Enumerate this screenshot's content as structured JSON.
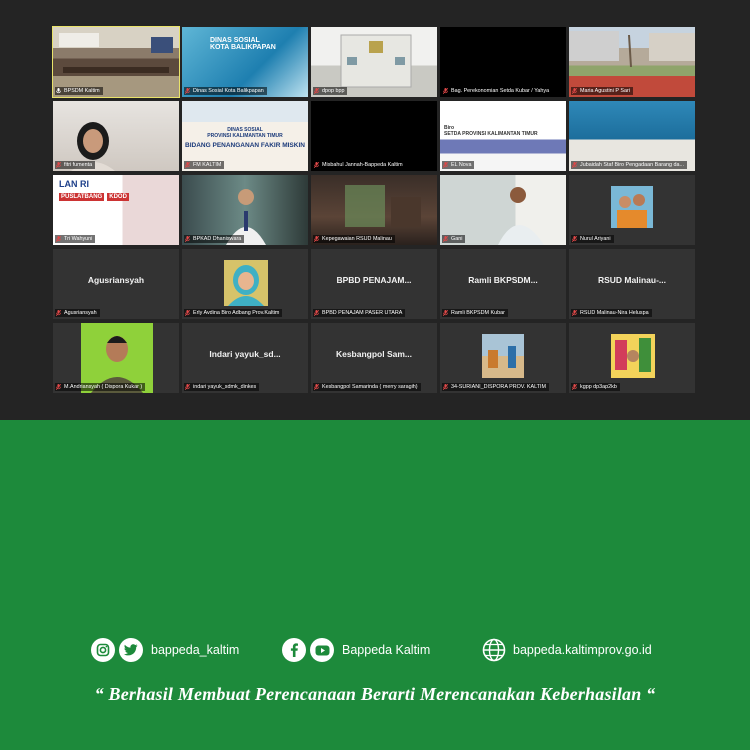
{
  "meeting": {
    "participants": [
      {
        "label": "BPSDM Kaltim",
        "center_name": "",
        "scene": "room",
        "active": true,
        "muted": false
      },
      {
        "label": "Dinas Sosial Kota Balikpapan",
        "center_name": "",
        "scene": "dinsos",
        "active": false,
        "muted": true,
        "overlay_lines": [
          "DINAS SOSIAL",
          "KOTA BALIKPAPAN"
        ]
      },
      {
        "label": "dpop bpp",
        "center_name": "",
        "scene": "building",
        "active": false,
        "muted": true
      },
      {
        "label": "Bag. Perekonomian Setda Kubar / Yahya",
        "center_name": "",
        "scene": "black",
        "active": false,
        "muted": true
      },
      {
        "label": "Maria Agustini P Sari",
        "center_name": "",
        "scene": "street",
        "active": false,
        "muted": true
      },
      {
        "label": "fitri fumenta",
        "center_name": "",
        "scene": "face",
        "active": false,
        "muted": true
      },
      {
        "label": "FM KALTIM",
        "center_name": "",
        "scene": "banner",
        "active": false,
        "muted": true,
        "overlay_lines": [
          "DINAS SOSIAL",
          "PROVINSI KALIMANTAN TIMUR",
          "BIDANG PENANGANAN FAKIR MISKIN"
        ]
      },
      {
        "label": "Misbahul Jannah-Bappeda Kaltim",
        "center_name": "",
        "scene": "black",
        "active": false,
        "muted": true
      },
      {
        "label": "EL Nova",
        "center_name": "",
        "scene": "slide",
        "active": false,
        "muted": true,
        "overlay_lines": [
          "Biro",
          "SETDA PROVINSI KALIMANTAN TIMUR"
        ]
      },
      {
        "label": "Jubaidah Staf Biro Pengadaan Barang da...",
        "center_name": "",
        "scene": "sky",
        "active": false,
        "muted": true
      },
      {
        "label": "Tri Wahyuni",
        "center_name": "",
        "scene": "lan",
        "active": false,
        "muted": true,
        "overlay_lines": [
          "LAN RI",
          "PUSLATBANG",
          "KDOD"
        ]
      },
      {
        "label": "BPKAD Dhaniswara",
        "center_name": "",
        "scene": "office",
        "active": false,
        "muted": true
      },
      {
        "label": "Kepegawaian RSUD Malinau",
        "center_name": "",
        "scene": "dark",
        "active": false,
        "muted": true
      },
      {
        "label": "Gani",
        "center_name": "",
        "scene": "man",
        "active": false,
        "muted": true
      },
      {
        "label": "Nurul Ariyani",
        "center_name": "",
        "scene": "thumb-kids",
        "active": false,
        "muted": true
      },
      {
        "label": "Agusriansyah",
        "center_name": "Agusriansyah",
        "scene": "none",
        "active": false,
        "muted": true
      },
      {
        "label": "Erly Avdina Biro Adbang Prov.Kaltim",
        "center_name": "",
        "scene": "thumb-hijab",
        "active": false,
        "muted": true
      },
      {
        "label": "BPBD PENAJAM PASER UTARA",
        "center_name": "BPBD  PENAJAM...",
        "scene": "none",
        "active": false,
        "muted": true
      },
      {
        "label": "Ramli BKPSDM Kubar",
        "center_name": "Ramli  BKPSDM...",
        "scene": "none",
        "active": false,
        "muted": true
      },
      {
        "label": "RSUD Malinau-Nira Heluspa",
        "center_name": "RSUD  Malinau-...",
        "scene": "none",
        "active": false,
        "muted": true
      },
      {
        "label": "M.Andriansyah ( Dispora Kukar )",
        "center_name": "",
        "scene": "thumb-officer",
        "active": false,
        "muted": true
      },
      {
        "label": "indari yayuk_sdmk_dinkes",
        "center_name": "Indari  yayuk_sd...",
        "scene": "none",
        "active": false,
        "muted": true
      },
      {
        "label": "Kesbangpol Samarinda ( merry saragih)",
        "center_name": "Kesbangpol  Sam...",
        "scene": "none",
        "active": false,
        "muted": true
      },
      {
        "label": "34-SURIANI_DISPORA PROV. KALTIM",
        "center_name": "",
        "scene": "thumb-beach",
        "active": false,
        "muted": true
      },
      {
        "label": "kgpp dp3ap2kb",
        "center_name": "",
        "scene": "thumb-play",
        "active": false,
        "muted": true
      }
    ]
  },
  "footer": {
    "instagram_handle": "bappeda_kaltim",
    "facebook_name": "Bappeda Kaltim",
    "website": "bappeda.kaltimprov.go.id",
    "motto": "“ Berhasil  Membuat Perencanaan Berarti Merencanakan Keberhasilan “",
    "icons": [
      "instagram-icon",
      "twitter-icon",
      "facebook-icon",
      "youtube-icon",
      "globe-icon"
    ],
    "colors": {
      "background": "#1d8a3b",
      "meeting_bg": "#242424",
      "active_speaker": "#e9e36a",
      "muted_mic": "#e04848"
    }
  }
}
